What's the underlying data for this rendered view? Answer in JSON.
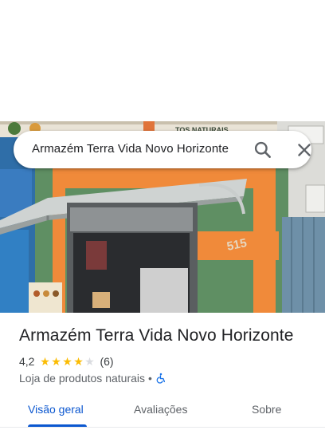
{
  "search": {
    "query": "Armazém Terra Vida Novo Horizonte",
    "search_icon": "search-icon",
    "close_icon": "close-icon"
  },
  "photo": {
    "sign_text": "TOS NATURAIS",
    "building_number": "515"
  },
  "place": {
    "name": "Armazém Terra Vida Novo Horizonte",
    "rating": "4,2",
    "stars": 4.2,
    "reviews": "(6)",
    "category": "Loja de produtos naturais",
    "separator": "•",
    "accessibility_icon": "wheelchair-icon"
  },
  "tabs": [
    {
      "label": "Visão geral",
      "active": true
    },
    {
      "label": "Avaliações",
      "active": false
    },
    {
      "label": "Sobre",
      "active": false
    }
  ],
  "colors": {
    "accent": "#0b57d0",
    "star": "#fbbc04",
    "star_empty": "#dadce0"
  }
}
